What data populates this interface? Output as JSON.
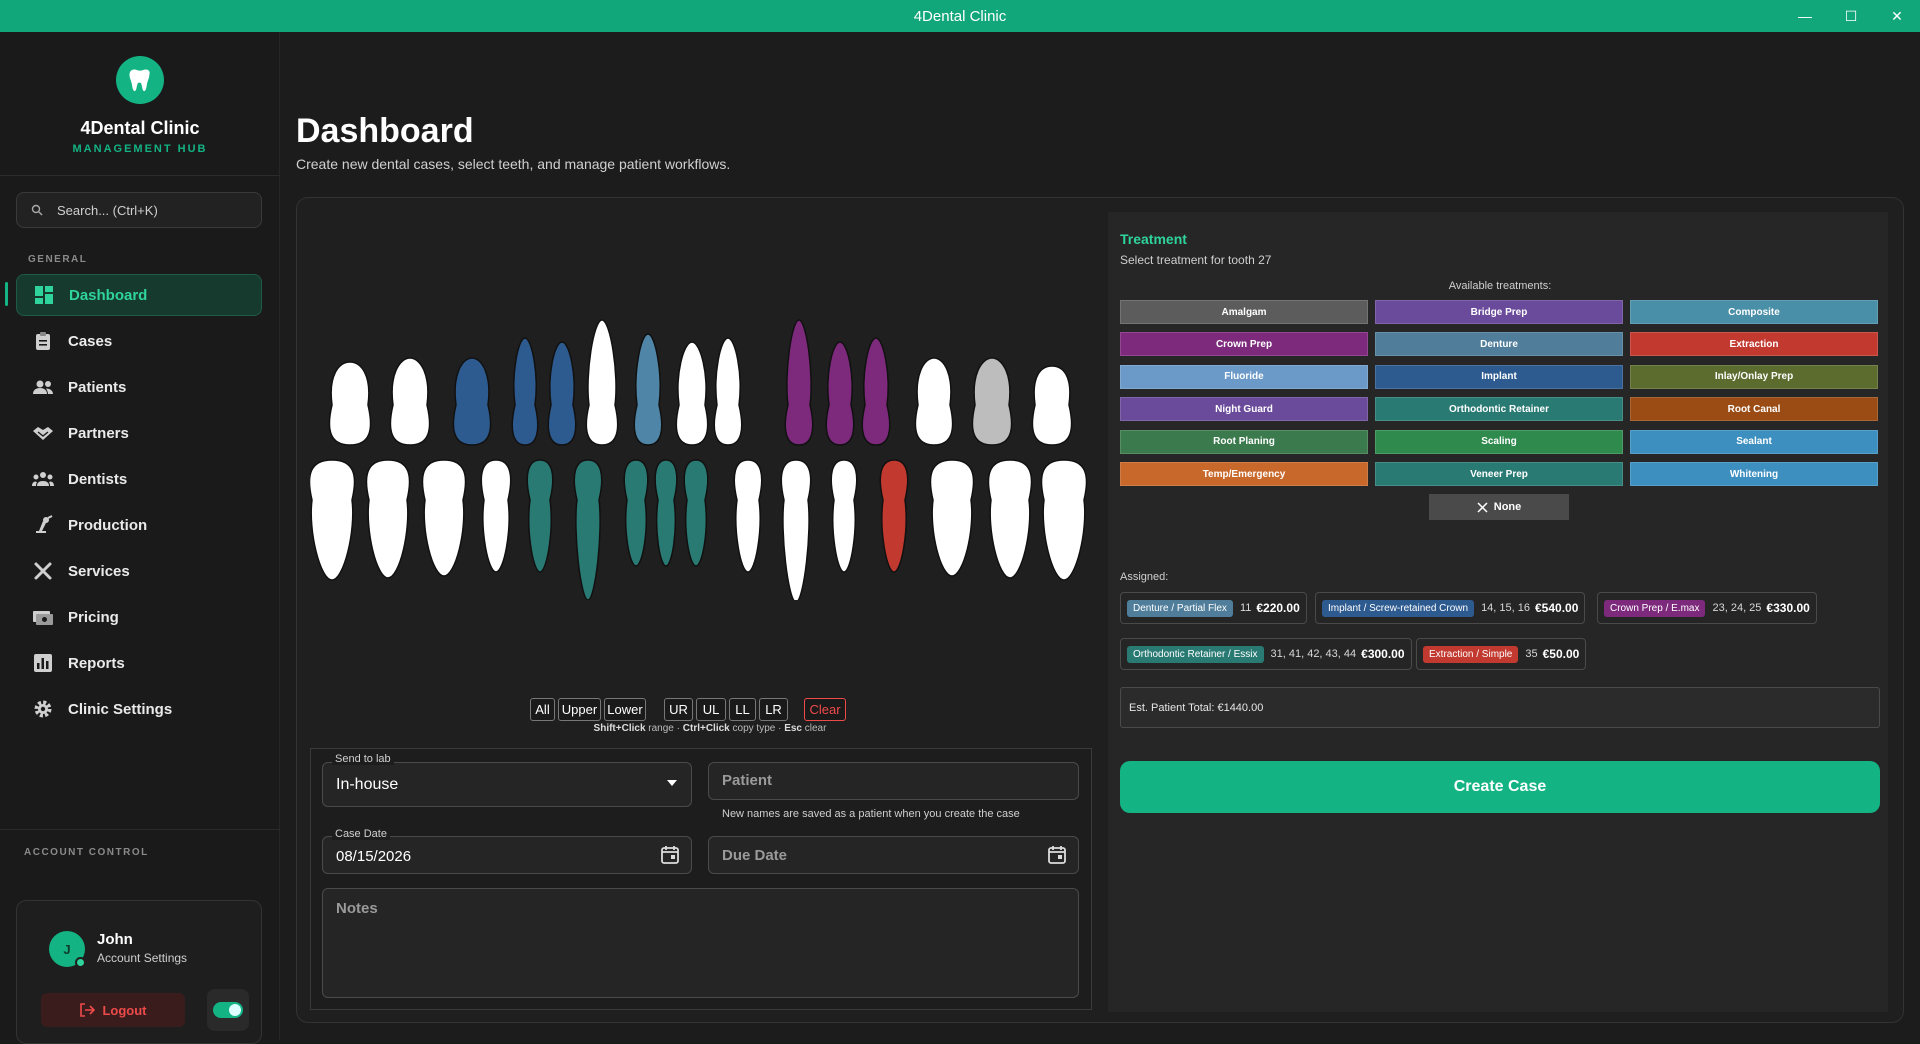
{
  "window": {
    "title": "4Dental Clinic"
  },
  "brand": {
    "title": "4Dental Clinic",
    "subtitle": "MANAGEMENT HUB"
  },
  "search": {
    "placeholder": "Search... (Ctrl+K)"
  },
  "sidebar": {
    "section_label": "GENERAL",
    "items": [
      {
        "label": "Dashboard",
        "icon": "dashboard-icon"
      },
      {
        "label": "Cases",
        "icon": "clipboard-icon"
      },
      {
        "label": "Patients",
        "icon": "people-icon"
      },
      {
        "label": "Partners",
        "icon": "handshake-icon"
      },
      {
        "label": "Dentists",
        "icon": "group-icon"
      },
      {
        "label": "Production",
        "icon": "production-icon"
      },
      {
        "label": "Services",
        "icon": "tools-icon"
      },
      {
        "label": "Pricing",
        "icon": "money-icon"
      },
      {
        "label": "Reports",
        "icon": "bar-chart-icon"
      },
      {
        "label": "Clinic Settings",
        "icon": "gear-icon"
      }
    ],
    "account_label": "ACCOUNT CONTROL"
  },
  "account": {
    "initial": "J",
    "name": "John",
    "settings": "Account Settings",
    "logout": "Logout"
  },
  "header": {
    "title": "Dashboard",
    "subtitle": "Create new dental cases, select teeth, and manage patient workflows."
  },
  "tooth_buttons": [
    "All",
    "Upper",
    "Lower",
    "UR",
    "UL",
    "LL",
    "LR",
    "Clear"
  ],
  "hint": {
    "k1": "Shift+Click",
    "t1": " range · ",
    "k2": "Ctrl+Click",
    "t2": " copy type · ",
    "k3": "Esc",
    "t3": " clear"
  },
  "form": {
    "lab_label": "Send to lab",
    "lab_value": "In-house",
    "patient_placeholder": "Patient",
    "patient_help": "New names are saved as a patient when you create the case",
    "case_date_label": "Case Date",
    "case_date_value": "08/15/2026",
    "due_date_placeholder": "Due Date",
    "notes_placeholder": "Notes"
  },
  "treatment": {
    "title": "Treatment",
    "subtitle": "Select treatment for tooth 27",
    "available_label": "Available treatments:",
    "options": [
      {
        "label": "Amalgam",
        "color": "#5c5c5c"
      },
      {
        "label": "Bridge Prep",
        "color": "#6a4a9a"
      },
      {
        "label": "Composite",
        "color": "#4a8fa8"
      },
      {
        "label": "Crown Prep",
        "color": "#7d2a7d"
      },
      {
        "label": "Denture",
        "color": "#4f7d9a"
      },
      {
        "label": "Extraction",
        "color": "#c2392f"
      },
      {
        "label": "Fluoride",
        "color": "#6b9ac8"
      },
      {
        "label": "Implant",
        "color": "#2d5a8f"
      },
      {
        "label": "Inlay/Onlay Prep",
        "color": "#5c6b2e"
      },
      {
        "label": "Night Guard",
        "color": "#6a4a9a"
      },
      {
        "label": "Orthodontic Retainer",
        "color": "#2a7a74"
      },
      {
        "label": "Root Canal",
        "color": "#9a4c14"
      },
      {
        "label": "Root Planing",
        "color": "#3a7a4d"
      },
      {
        "label": "Scaling",
        "color": "#2e8a4d"
      },
      {
        "label": "Sealant",
        "color": "#3d8fc0"
      },
      {
        "label": "Temp/Emergency",
        "color": "#c8682a"
      },
      {
        "label": "Veneer Prep",
        "color": "#2a7a74"
      },
      {
        "label": "Whitening",
        "color": "#3d8fc0"
      }
    ],
    "none_label": "None",
    "assigned_label": "Assigned:",
    "assigned": [
      {
        "type": "Denture / Partial Flex",
        "teeth": "11",
        "amount": "€220.00",
        "color": "#4f7d9a"
      },
      {
        "type": "Implant / Screw-retained Crown",
        "teeth": "14, 15, 16",
        "amount": "€540.00",
        "color": "#2d5a8f"
      },
      {
        "type": "Crown Prep / E.max",
        "teeth": "23, 24, 25",
        "amount": "€330.00",
        "color": "#7d2a7d"
      },
      {
        "type": "Orthodontic Retainer / Essix",
        "teeth": "31, 41, 42, 43, 44",
        "amount": "€300.00",
        "color": "#2a7a74"
      },
      {
        "type": "Extraction / Simple",
        "teeth": "35",
        "amount": "€50.00",
        "color": "#c2392f"
      }
    ],
    "estimate": "Est. Patient Total: €1440.00",
    "create_label": "Create Case"
  },
  "teeth": {
    "upper": [
      {
        "color": "#ffffff"
      },
      {
        "color": "#ffffff"
      },
      {
        "color": "#2d5a8f"
      },
      {
        "color": "#2d5a8f"
      },
      {
        "color": "#2d5a8f"
      },
      {
        "color": "#ffffff"
      },
      {
        "color": "#4f86a8"
      },
      {
        "color": "#ffffff"
      },
      {
        "color": "#ffffff"
      },
      {
        "color": "#7d2a7d"
      },
      {
        "color": "#7d2a7d"
      },
      {
        "color": "#7d2a7d"
      },
      {
        "color": "#ffffff"
      },
      {
        "color": "#bdbdbd"
      },
      {
        "color": "#ffffff"
      }
    ],
    "lower": [
      {
        "color": "#ffffff"
      },
      {
        "color": "#ffffff"
      },
      {
        "color": "#ffffff"
      },
      {
        "color": "#ffffff"
      },
      {
        "color": "#2a7a74"
      },
      {
        "color": "#2a7a74"
      },
      {
        "color": "#2a7a74"
      },
      {
        "color": "#2a7a74"
      },
      {
        "color": "#2a7a74"
      },
      {
        "color": "#ffffff"
      },
      {
        "color": "#ffffff"
      },
      {
        "color": "#ffffff"
      },
      {
        "color": "#c2392f"
      },
      {
        "color": "#ffffff"
      },
      {
        "color": "#ffffff"
      },
      {
        "color": "#ffffff"
      }
    ]
  }
}
